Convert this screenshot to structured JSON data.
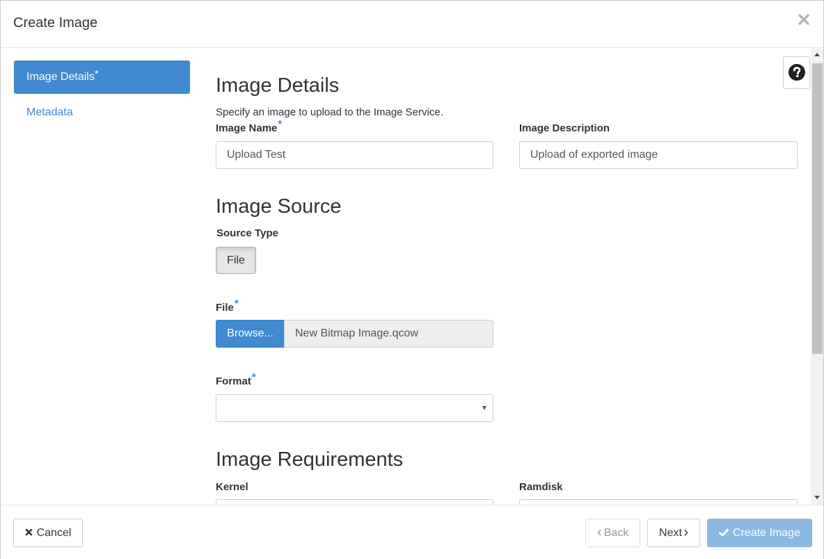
{
  "dialog": {
    "title": "Create Image",
    "close_icon": "close-icon"
  },
  "sidebar": {
    "items": [
      {
        "label": "Image Details",
        "required_mark": "*",
        "active": true
      },
      {
        "label": "Metadata",
        "active": false
      }
    ]
  },
  "help": {
    "icon": "question-circle-icon"
  },
  "details": {
    "title": "Image Details",
    "help_text": "Specify an image to upload to the Image Service.",
    "name_label": "Image Name",
    "name_value": "Upload Test",
    "description_label": "Image Description",
    "description_value": "Upload of exported image",
    "required_mark": "*"
  },
  "source": {
    "title": "Image Source",
    "type_label": "Source Type",
    "type_button": "File",
    "file_label": "File",
    "browse_label": "Browse...",
    "file_name": "New Bitmap Image.qcow",
    "format_label": "Format",
    "format_value": ""
  },
  "requirements": {
    "title": "Image Requirements",
    "kernel_label": "Kernel",
    "ramdisk_label": "Ramdisk"
  },
  "footer": {
    "cancel_label": "Cancel",
    "back_label": "Back",
    "next_label": "Next",
    "create_label": "Create Image"
  },
  "colors": {
    "primary": "#3f8ad0",
    "primary_disabled": "#8bb9e2"
  }
}
